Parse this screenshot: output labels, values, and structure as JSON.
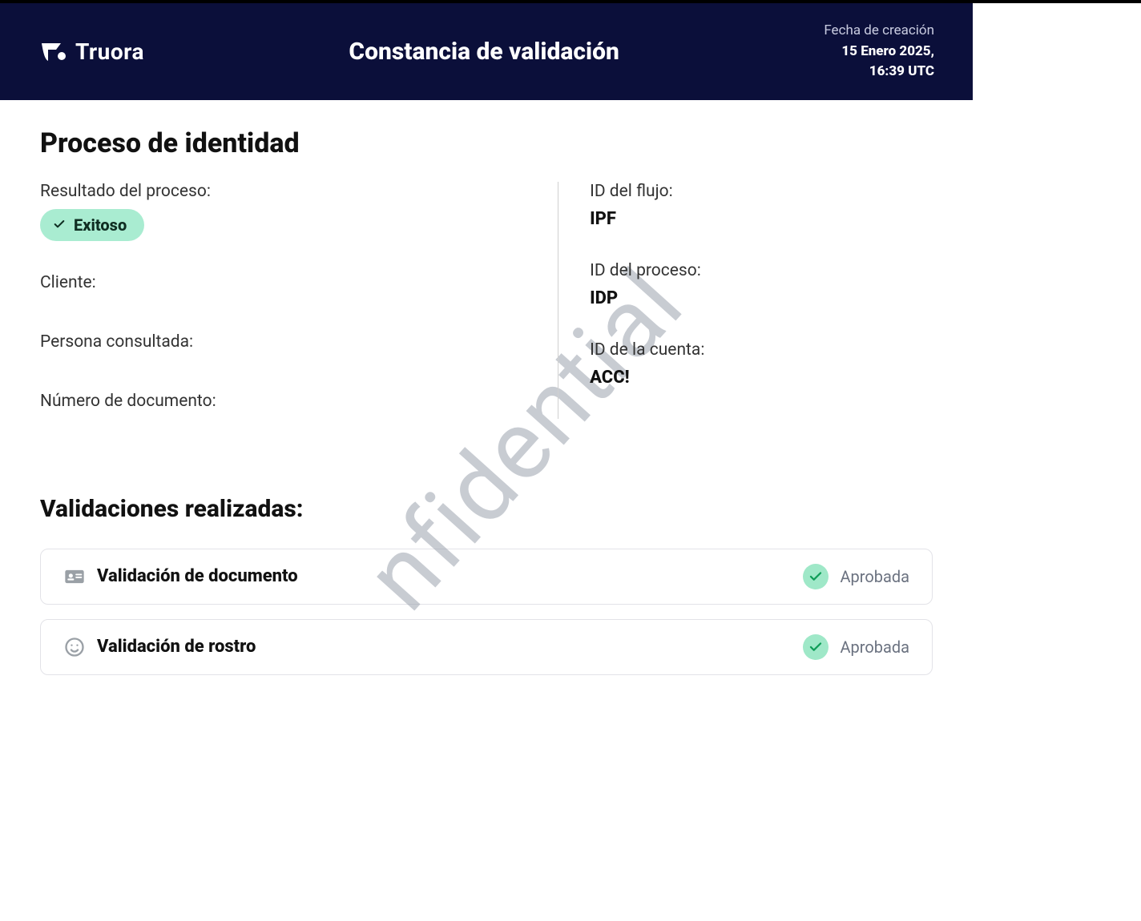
{
  "header": {
    "brand": "Truora",
    "title": "Constancia de validación",
    "creation_label": "Fecha de creación",
    "creation_value_line1": "15 Enero 2025,",
    "creation_value_line2": "16:39 UTC"
  },
  "identity": {
    "section_title": "Proceso de identidad",
    "left": {
      "result_label": "Resultado del proceso:",
      "result_status": "Exitoso",
      "client_label": "Cliente:",
      "client_value": "",
      "person_label": "Persona consultada:",
      "person_value": "",
      "docnum_label": "Número de documento:",
      "docnum_value": ""
    },
    "right": {
      "flow_label": "ID del flujo:",
      "flow_value": "IPF",
      "process_label": "ID del proceso:",
      "process_value": "IDP",
      "account_label": "ID de la cuenta:",
      "account_value": "ACC!"
    }
  },
  "validations": {
    "title": "Validaciones realizadas:",
    "items": [
      {
        "name": "Validación de documento",
        "status": "Aprobada",
        "icon": "id-card"
      },
      {
        "name": "Validación de rostro",
        "status": "Aprobada",
        "icon": "face"
      }
    ]
  },
  "watermark": "nfidential"
}
